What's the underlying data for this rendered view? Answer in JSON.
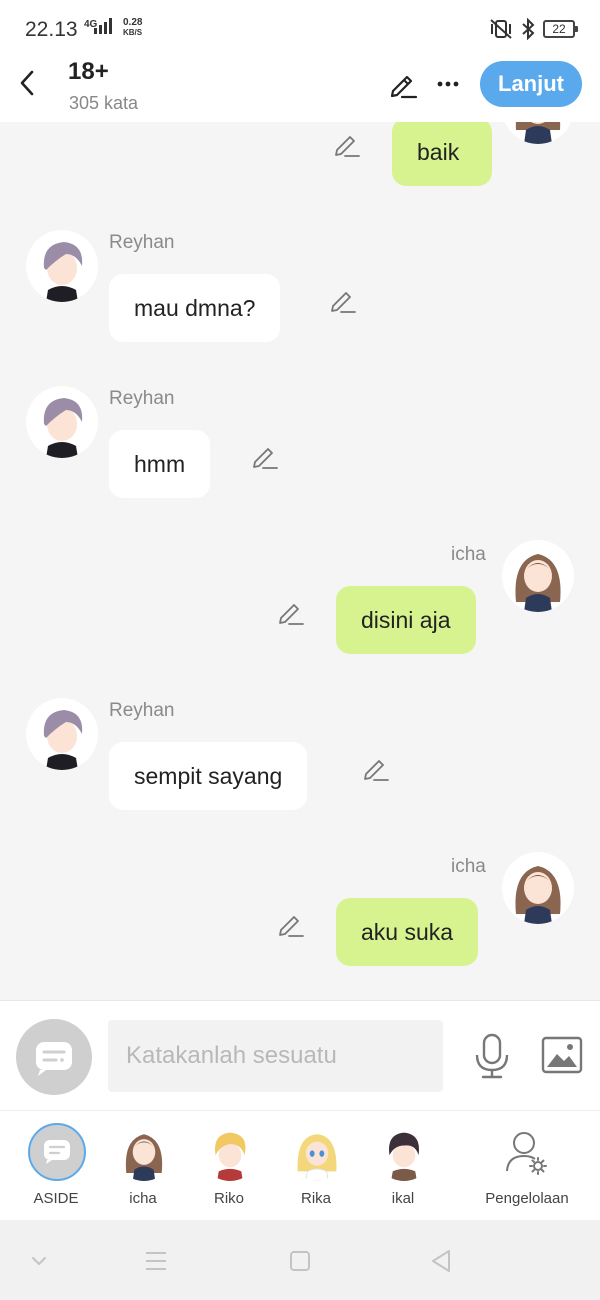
{
  "status_bar": {
    "time": "22.13",
    "network": "4G",
    "speed_value": "0.28",
    "speed_unit": "KB/S",
    "battery": "22"
  },
  "header": {
    "title": "18+",
    "word_count": "305 kata",
    "next_label": "Lanjut"
  },
  "messages": [
    {
      "side": "right",
      "sender": "",
      "text": "baik"
    },
    {
      "side": "left",
      "sender": "Reyhan",
      "text": "mau dmna?"
    },
    {
      "side": "left",
      "sender": "Reyhan",
      "text": "hmm"
    },
    {
      "side": "right",
      "sender": "icha",
      "text": "disini aja"
    },
    {
      "side": "left",
      "sender": "Reyhan",
      "text": "sempit sayang"
    },
    {
      "side": "right",
      "sender": "icha",
      "text": "aku suka"
    }
  ],
  "input": {
    "placeholder": "Katakanlah sesuatu"
  },
  "characters": [
    {
      "label": "ASIDE"
    },
    {
      "label": "icha"
    },
    {
      "label": "Riko"
    },
    {
      "label": "Rika"
    },
    {
      "label": "ikal"
    },
    {
      "label": "Pengelolaan"
    }
  ],
  "colors": {
    "accent": "#5aa9ec",
    "my_bubble": "#d7f38f",
    "other_bubble": "#ffffff",
    "background": "#f5f5f5"
  }
}
